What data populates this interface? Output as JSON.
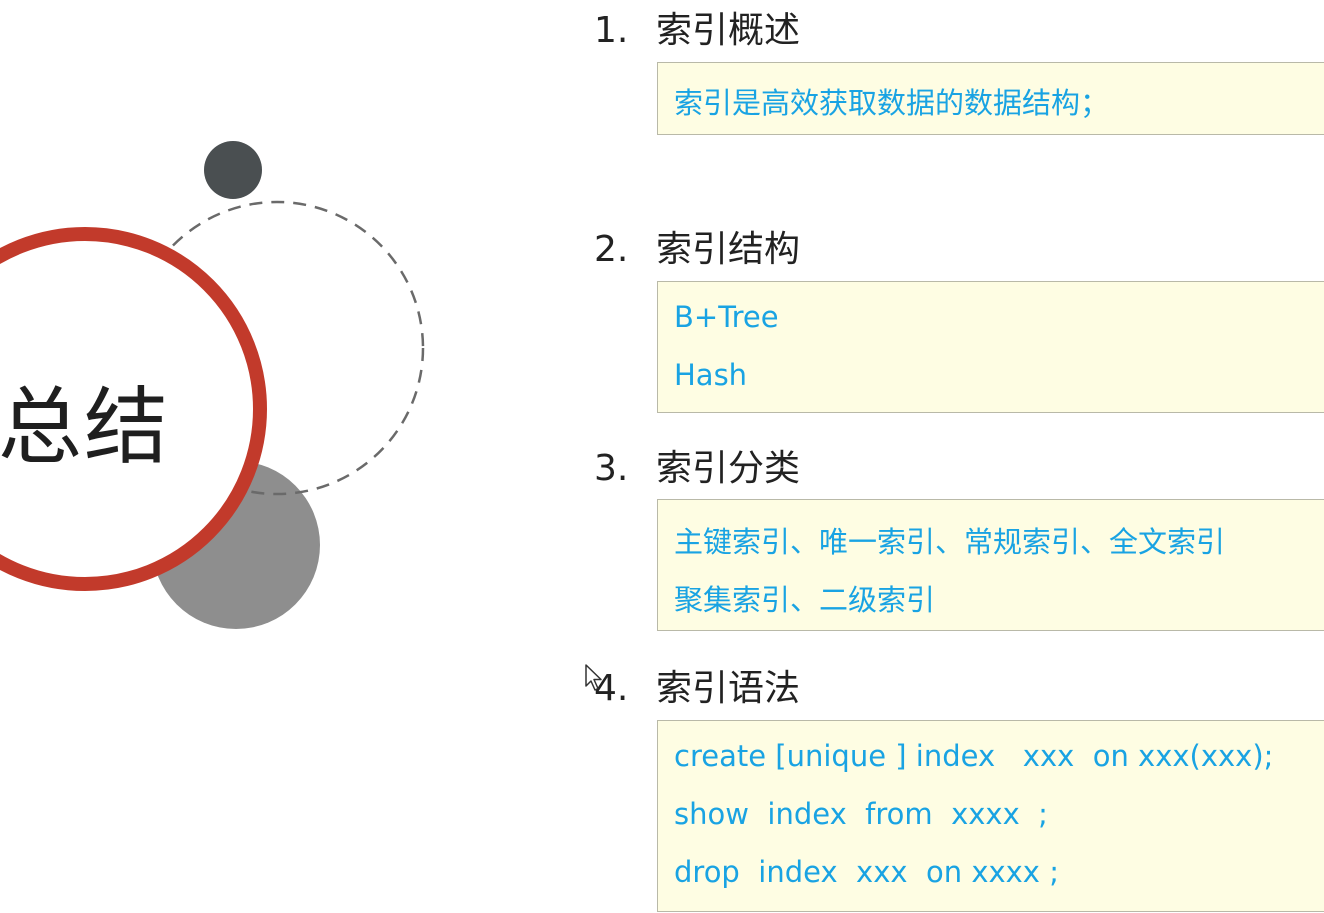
{
  "slide_title": "总结",
  "sections": [
    {
      "number": "1.",
      "heading": "索引概述",
      "lines": [
        "索引是高效获取数据的数据结构；"
      ]
    },
    {
      "number": "2.",
      "heading": "索引结构",
      "lines": [
        "B+Tree",
        "Hash"
      ]
    },
    {
      "number": "3.",
      "heading": "索引分类",
      "lines": [
        "主键索引、唯一索引、常规索引、全文索引",
        "聚集索引、二级索引"
      ]
    },
    {
      "number": "4.",
      "heading": "索引语法",
      "lines": [
        "create [unique ] index   xxx  on xxx(xxx);",
        "show  index  from  xxxx  ;",
        "drop  index  xxx  on xxxx ;"
      ]
    }
  ],
  "colors": {
    "accent_ring": "#c23a2b",
    "box_text": "#19a3e3",
    "box_bg": "#fefde3",
    "dark_dot": "#4a4f51",
    "grey_circle": "#8e8e8e"
  },
  "icons": {
    "cursor": "mouse-pointer-icon"
  }
}
